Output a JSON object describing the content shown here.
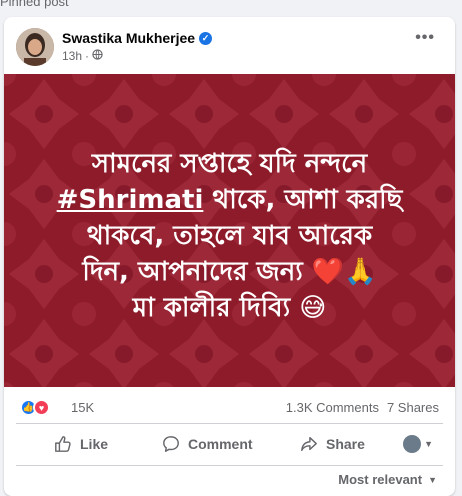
{
  "pinned_label": "Pinned post",
  "post": {
    "author": "Swastika Mukherjee",
    "time": "13h",
    "more_label": "•••",
    "image_text": {
      "line1": "সামনের সপ্তাহে যদি নন্দনে",
      "hashtag": "#Shrimati",
      "line2_rest": " থাকে, আশা করছি",
      "line3": "থাকবে, তাহলে যাব আরেক",
      "line4": "দিন, আপনাদের জন্য ❤️🙏",
      "line5": "মা কালীর দিব্যি 😅"
    },
    "reaction_count": "15K",
    "comments": "1.3K Comments",
    "shares": "7 Shares",
    "actions": {
      "like": "Like",
      "comment": "Comment",
      "share": "Share"
    },
    "sort_label": "Most relevant"
  },
  "colors": {
    "image_bg": "#8e1b2a",
    "like_blue": "#1877f2",
    "love_red": "#f33e58"
  }
}
